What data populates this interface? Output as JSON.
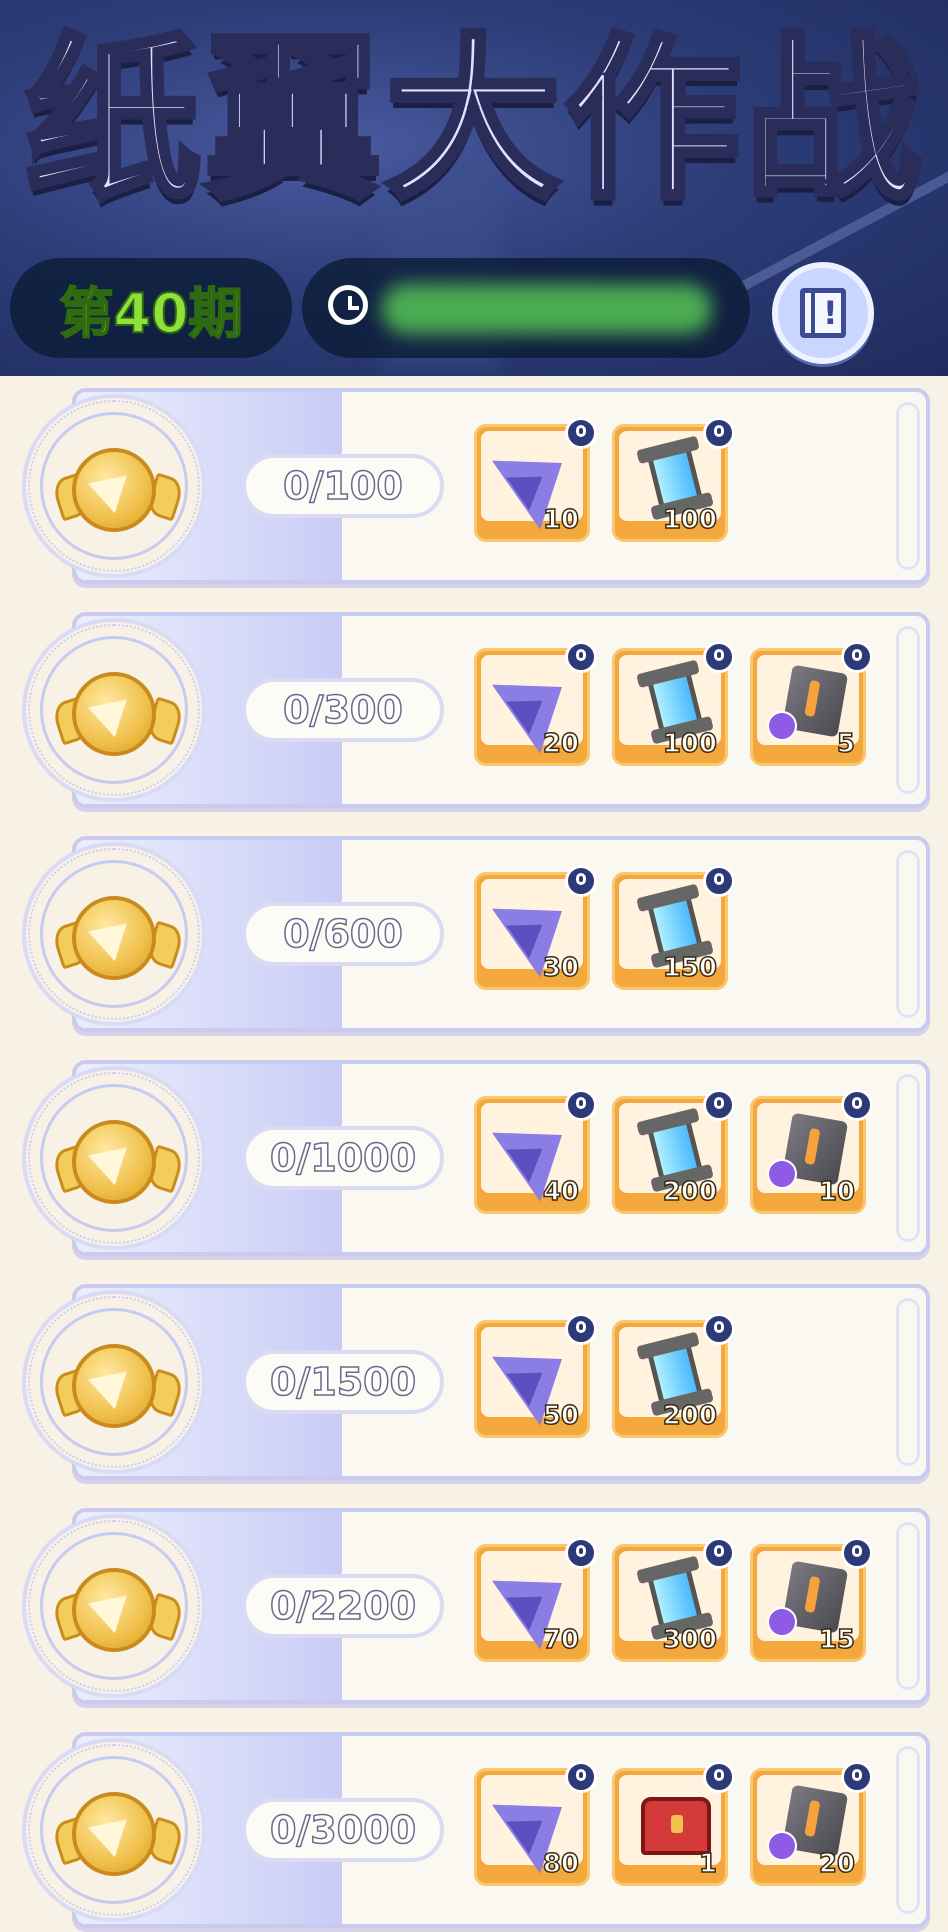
{
  "header": {
    "title": "纸翼大作战",
    "issue_label": "第40期",
    "timer_text": "",
    "rules_button_glyph": "!"
  },
  "tiers": [
    {
      "progress": "0/100",
      "rewards": [
        {
          "icon": "paper-plane-icon",
          "qty": "10"
        },
        {
          "icon": "energy-tube-icon",
          "qty": "100"
        }
      ]
    },
    {
      "progress": "0/300",
      "rewards": [
        {
          "icon": "paper-plane-icon",
          "qty": "20"
        },
        {
          "icon": "energy-tube-icon",
          "qty": "100"
        },
        {
          "icon": "iron-block-icon",
          "qty": "5"
        }
      ]
    },
    {
      "progress": "0/600",
      "rewards": [
        {
          "icon": "paper-plane-icon",
          "qty": "30"
        },
        {
          "icon": "energy-tube-icon",
          "qty": "150"
        }
      ]
    },
    {
      "progress": "0/1000",
      "rewards": [
        {
          "icon": "paper-plane-icon",
          "qty": "40"
        },
        {
          "icon": "energy-tube-icon",
          "qty": "200"
        },
        {
          "icon": "iron-block-icon",
          "qty": "10"
        }
      ]
    },
    {
      "progress": "0/1500",
      "rewards": [
        {
          "icon": "paper-plane-icon",
          "qty": "50"
        },
        {
          "icon": "energy-tube-icon",
          "qty": "200"
        }
      ]
    },
    {
      "progress": "0/2200",
      "rewards": [
        {
          "icon": "paper-plane-icon",
          "qty": "70"
        },
        {
          "icon": "energy-tube-icon",
          "qty": "300"
        },
        {
          "icon": "iron-block-icon",
          "qty": "15"
        }
      ]
    },
    {
      "progress": "0/3000",
      "rewards": [
        {
          "icon": "paper-plane-icon",
          "qty": "80"
        },
        {
          "icon": "treasure-chest-icon",
          "qty": "1"
        },
        {
          "icon": "iron-block-icon",
          "qty": "20"
        }
      ]
    }
  ],
  "colors": {
    "accent": "#8fe13a",
    "card_border": "#c9cbee",
    "reward_tile": "#f3a73c"
  }
}
